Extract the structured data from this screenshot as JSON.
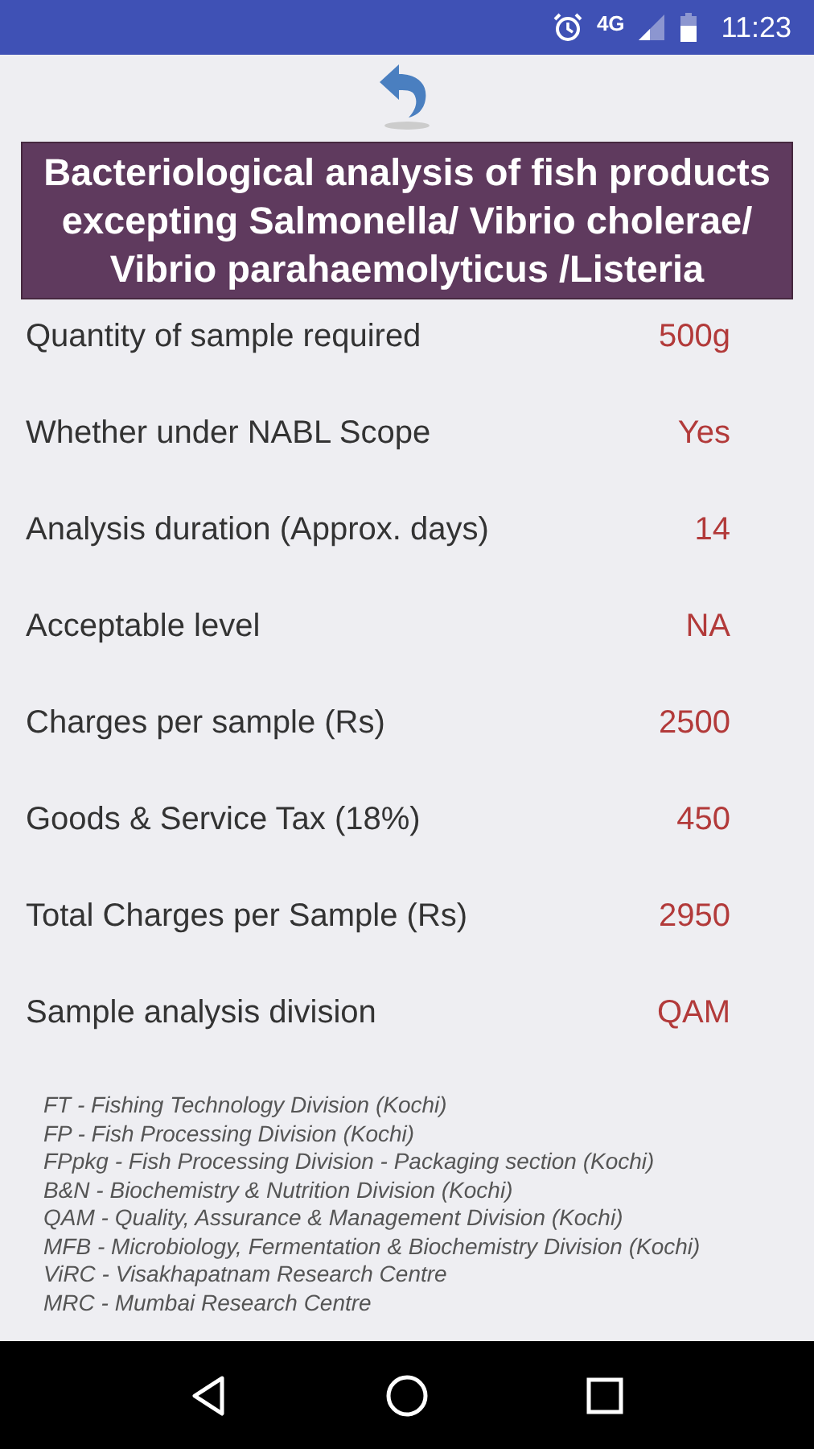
{
  "status_bar": {
    "network": "4G",
    "time": "11:23"
  },
  "title": "Bacteriological analysis of fish products excepting Salmonella/ Vibrio cholerae/ Vibrio parahaemolyticus /Listeria",
  "details": [
    {
      "label": "Quantity of sample required",
      "value": "500g"
    },
    {
      "label": "Whether under NABL Scope",
      "value": "Yes"
    },
    {
      "label": "Analysis duration (Approx. days)",
      "value": "14"
    },
    {
      "label": "Acceptable level",
      "value": "NA"
    },
    {
      "label": "Charges per sample (Rs)",
      "value": "2500"
    },
    {
      "label": "Goods & Service Tax (18%)",
      "value": "450"
    },
    {
      "label": "Total Charges per Sample (Rs)",
      "value": "2950"
    },
    {
      "label": "Sample analysis division",
      "value": "QAM"
    }
  ],
  "legend": [
    "FT - Fishing Technology Division (Kochi)",
    "FP - Fish Processing Division (Kochi)",
    "FPpkg - Fish Processing Division - Packaging section (Kochi)",
    "B&N - Biochemistry & Nutrition Division (Kochi)",
    "QAM - Quality, Assurance & Management Division (Kochi)",
    "MFB - Microbiology, Fermentation & Biochemistry Division (Kochi)",
    "ViRC - Visakhapatnam Research Centre",
    "MRC - Mumbai Research Centre"
  ]
}
